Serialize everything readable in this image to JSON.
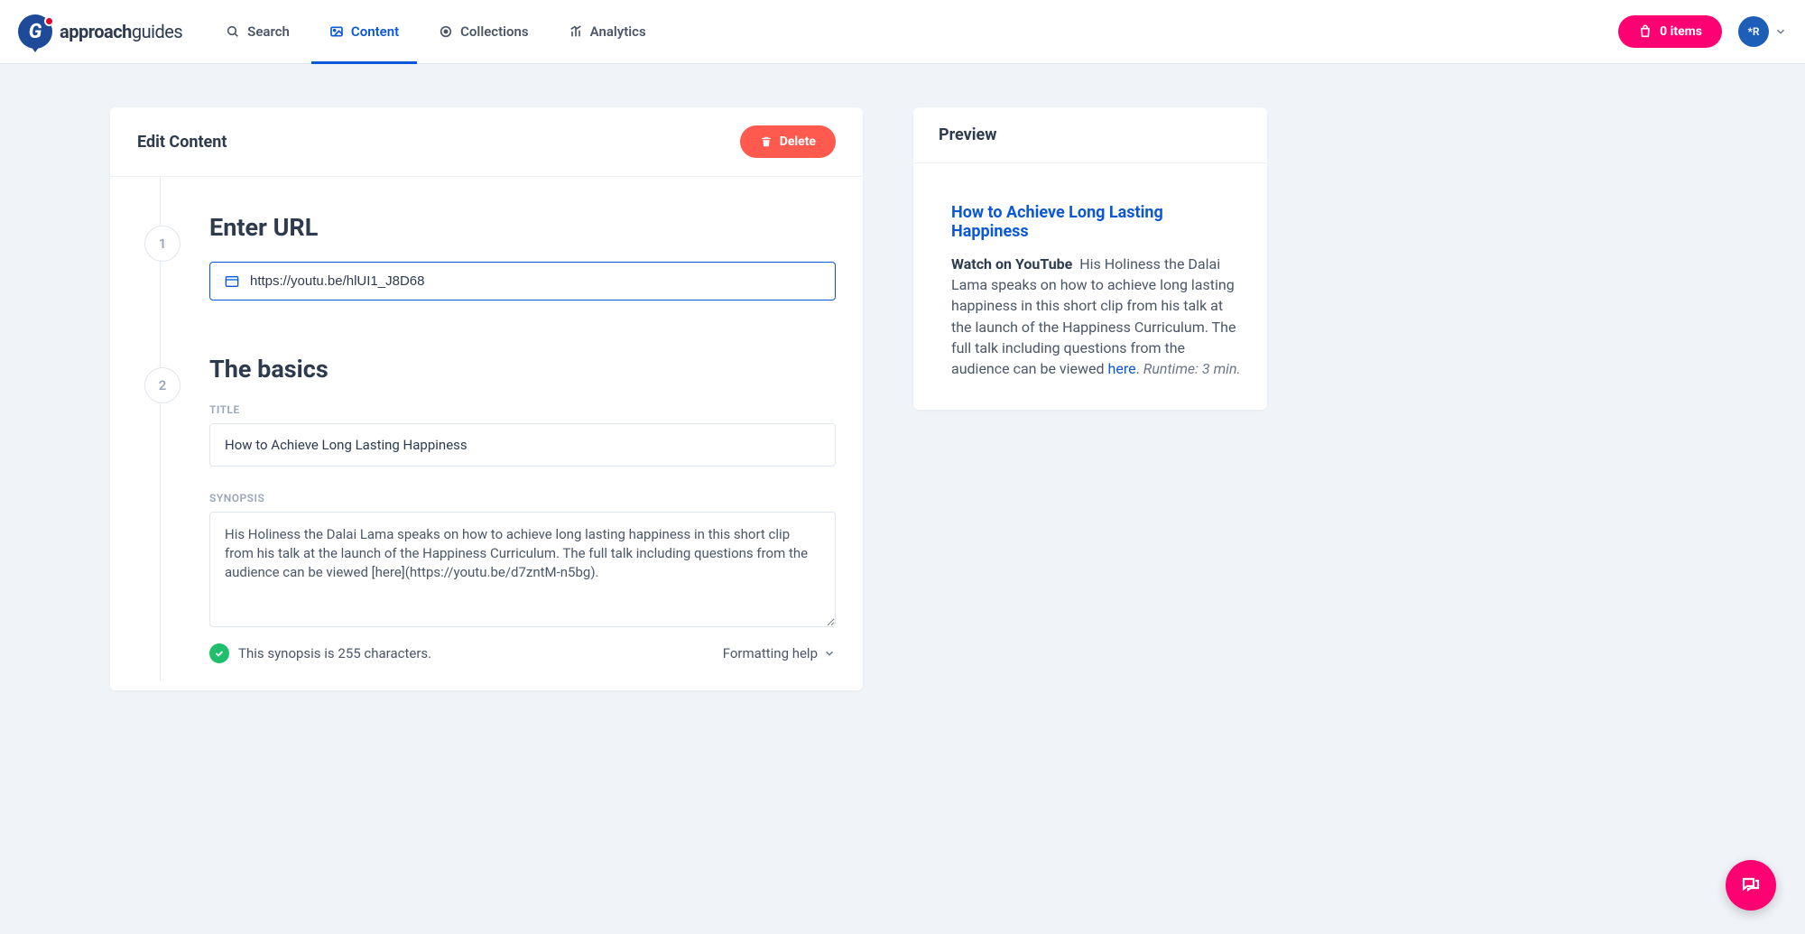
{
  "brand": {
    "name_bold": "approach",
    "name_light": "guides"
  },
  "nav": {
    "search": "Search",
    "content": "Content",
    "collections": "Collections",
    "analytics": "Analytics"
  },
  "header": {
    "cart_label": "0 items",
    "avatar_initials": "*R"
  },
  "main": {
    "title": "Edit Content",
    "delete_label": "Delete",
    "steps": {
      "url": {
        "num": "1",
        "heading": "Enter URL",
        "value": "https://youtu.be/hlUI1_J8D68"
      },
      "basics": {
        "num": "2",
        "heading": "The basics",
        "title_label": "TITLE",
        "title_value": "How to Achieve Long Lasting Happiness",
        "synopsis_label": "SYNOPSIS",
        "synopsis_value": "His Holiness the Dalai Lama speaks on how to achieve long lasting happiness in this short clip from his talk at the launch of the Happiness Curriculum. The full talk including questions from the audience can be viewed [here](https://youtu.be/d7zntM-n5bg).",
        "status_text": "This synopsis is 255 characters.",
        "formatting_help": "Formatting help"
      }
    }
  },
  "preview": {
    "heading": "Preview",
    "title": "How to Achieve Long Lasting Happiness",
    "lead": "Watch on YouTube",
    "body_pre_link": "His Holiness the Dalai Lama speaks on how to achieve long lasting happiness in this short clip from his talk at the launch of the Happiness Curriculum. The full talk including questions from the audience can be viewed ",
    "link_text": "here",
    "body_post_link": ".  ",
    "runtime": "Runtime: 3 min."
  }
}
